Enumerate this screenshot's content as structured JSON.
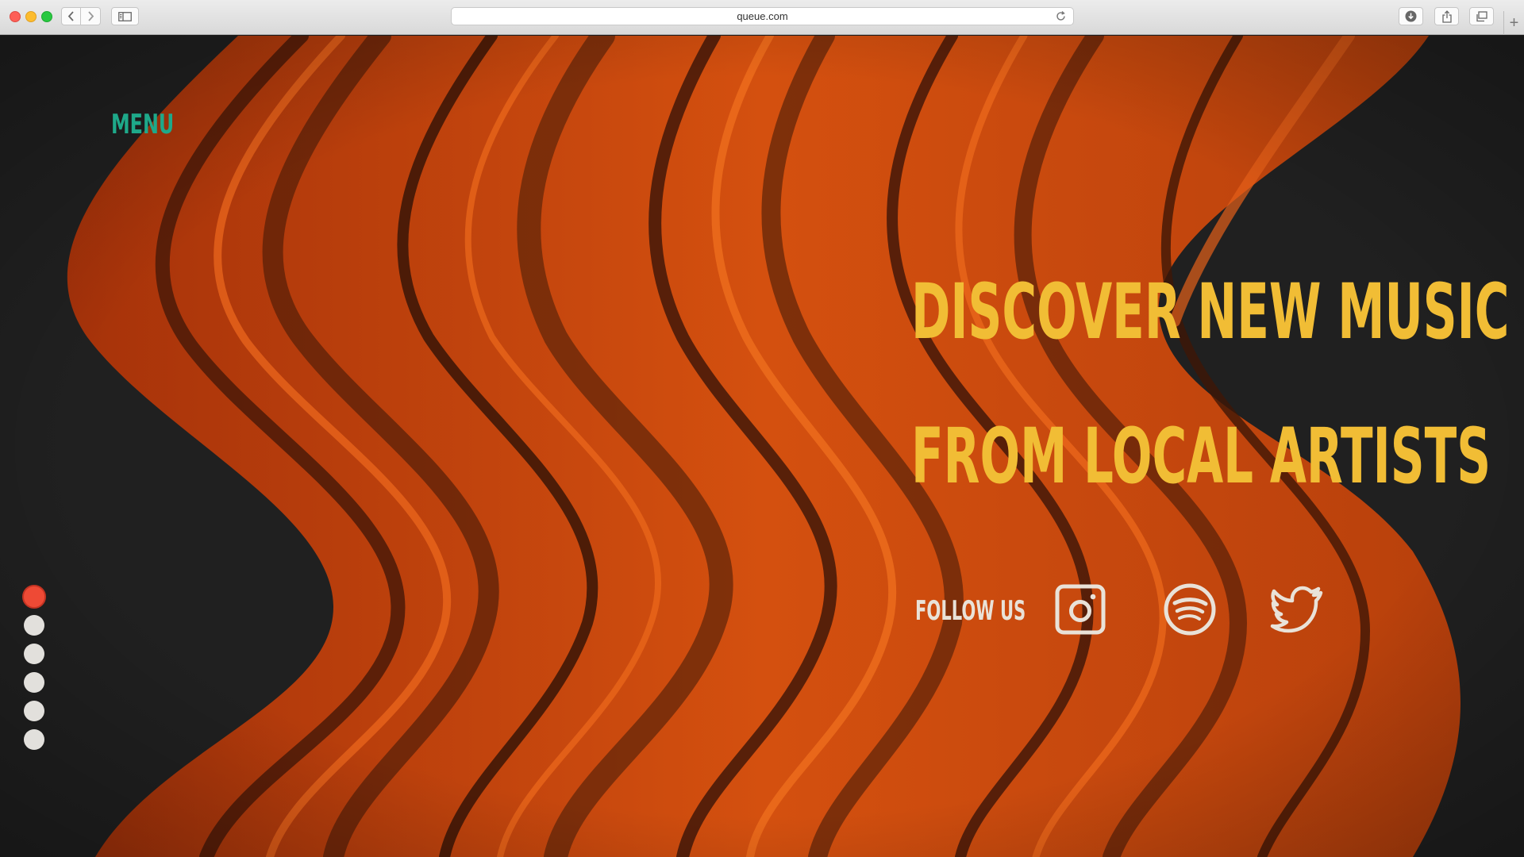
{
  "browser": {
    "url": "queue.com"
  },
  "page": {
    "menu_label": "MENU",
    "headline_line1": "DISCOVER NEW MUSIC",
    "headline_line2": "FROM LOCAL ARTISTS",
    "follow_label": "FOLLOW US",
    "social_icons": [
      "instagram-icon",
      "spotify-icon",
      "twitter-icon"
    ],
    "pager_dots": 6,
    "active_dot": 1
  },
  "colors": {
    "menu": "#1ea98a",
    "headline": "#f1bd35",
    "follow": "#e9e2d8",
    "active_dot": "#ee4a35",
    "inactive_dot": "#e2e0dc",
    "background": "#1f1f1f",
    "wave": "#c9440f"
  }
}
